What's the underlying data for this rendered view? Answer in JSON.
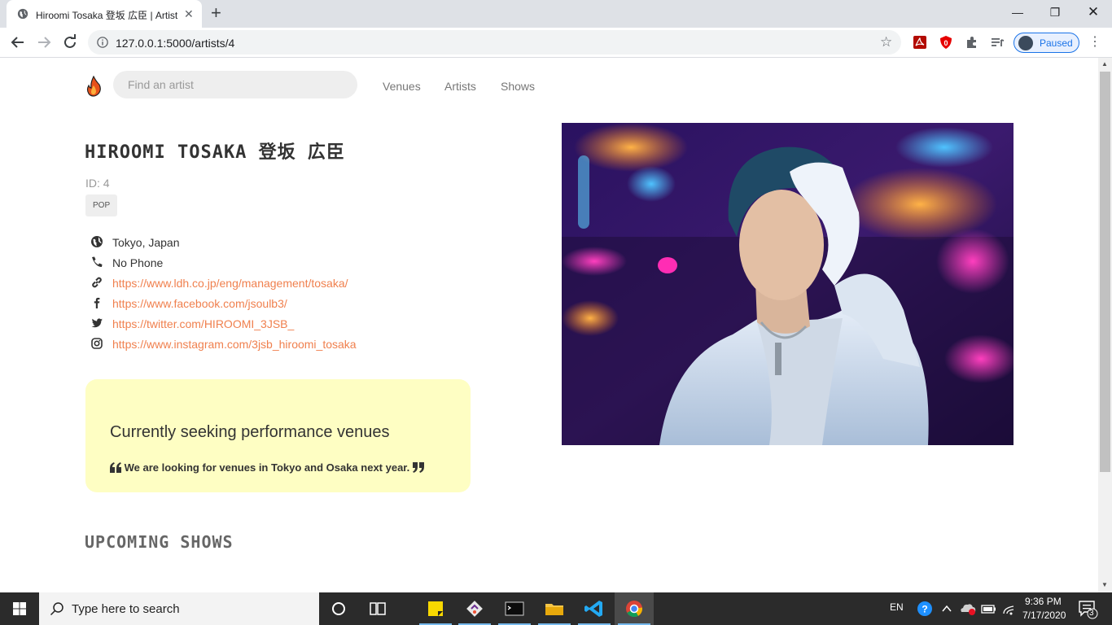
{
  "browser": {
    "tab_title": "Hiroomi Tosaka 登坂 広臣 | Artist",
    "url": "127.0.0.1:5000/artists/4",
    "profile_label": "Paused"
  },
  "site": {
    "search_placeholder": "Find an artist",
    "nav": [
      "Venues",
      "Artists",
      "Shows"
    ]
  },
  "artist": {
    "name": "HIROOMI TOSAKA 登坂 広臣",
    "id_text": "ID: 4",
    "genre": "POP",
    "location": "Tokyo, Japan",
    "phone": "No Phone",
    "website": "https://www.ldh.co.jp/eng/management/tosaka/",
    "facebook": "https://www.facebook.com/jsoulb3/",
    "twitter": "https://twitter.com/HIROOMI_3JSB_",
    "instagram": "https://www.instagram.com/3jsb_hiroomi_tosaka"
  },
  "seeking": {
    "title": "Currently seeking performance venues",
    "description": "We are looking for venues in Tokyo and Osaka next year."
  },
  "sections": {
    "upcoming_title": "UPCOMING SHOWS"
  },
  "taskbar": {
    "search_text": "Type here to search",
    "lang": "EN",
    "time": "9:36 PM",
    "date": "7/17/2020",
    "notification_count": "3"
  },
  "colors": {
    "accent_link": "#f0804e",
    "seeking_bg": "#fefec3",
    "profile_blue": "#1a73e8"
  }
}
